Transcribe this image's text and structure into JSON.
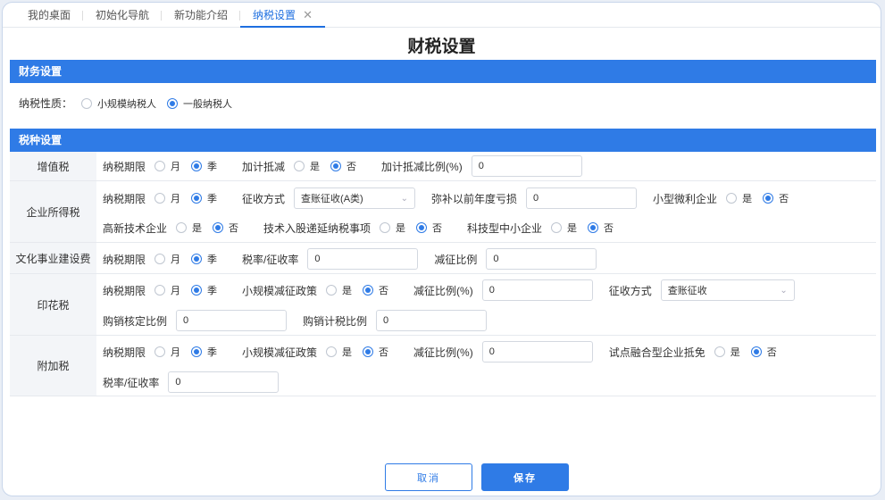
{
  "tabs": [
    {
      "label": "我的桌面"
    },
    {
      "label": "初始化导航"
    },
    {
      "label": "新功能介绍"
    },
    {
      "label": "纳税设置",
      "close": "✕"
    }
  ],
  "page_title": "财税设置",
  "finance": {
    "header": "财务设置",
    "taxpayer_label": "纳税性质：",
    "opt_small": "小规模纳税人",
    "opt_general": "一般纳税人"
  },
  "taxes": {
    "header": "税种设置",
    "common": {
      "period": "纳税期限",
      "month": "月",
      "quarter": "季",
      "yes": "是",
      "no": "否"
    },
    "vat": {
      "label": "增值税",
      "extra_deduction": "加计抵减",
      "extra_ratio_label": "加计抵减比例(%)",
      "extra_ratio_value": "0"
    },
    "cit": {
      "label": "企业所得税",
      "levy_method_label": "征收方式",
      "levy_method_value": "查账征收(A类)",
      "loss_label": "弥补以前年度亏损",
      "loss_value": "0",
      "small_micro": "小型微利企业",
      "high_tech": "高新技术企业",
      "tech_share": "技术入股递延纳税事项",
      "sme_tech": "科技型中小企业"
    },
    "culture": {
      "label": "文化事业建设费",
      "rate_label": "税率/征收率",
      "rate_value": "0",
      "reduce_label": "减征比例",
      "reduce_value": "0"
    },
    "stamp": {
      "label": "印花税",
      "small_policy": "小规模减征政策",
      "reduce_label": "减征比例(%)",
      "reduce_value": "0",
      "levy_label": "征收方式",
      "levy_value": "查账征收",
      "purchase_label": "购销核定比例",
      "purchase_value": "0",
      "tax_ratio_label": "购销计税比例",
      "tax_ratio_value": "0"
    },
    "surcharge": {
      "label": "附加税",
      "small_policy": "小规模减征政策",
      "reduce_label": "减征比例(%)",
      "reduce_value": "0",
      "pilot_label": "试点融合型企业抵免",
      "rate_label": "税率/征收率",
      "rate_value": "0"
    }
  },
  "buttons": {
    "cancel": "取消",
    "save": "保存"
  },
  "colors": {
    "accent": "#2f7be6"
  }
}
